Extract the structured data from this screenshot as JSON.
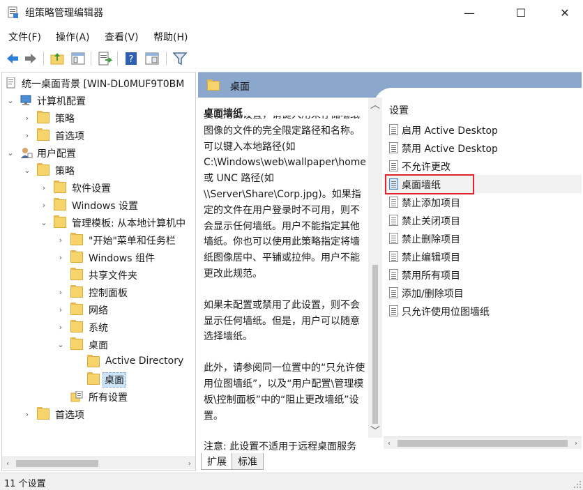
{
  "window": {
    "title": "组策略管理编辑器",
    "controls": {
      "minimize": "—",
      "maximize": "☐",
      "close": "✕"
    }
  },
  "menu": [
    "文件(F)",
    "操作(A)",
    "查看(V)",
    "帮助(H)"
  ],
  "toolbar": [
    "back-icon",
    "forward-icon",
    "up-folder-icon",
    "show-hide-tree-icon",
    "export-list-icon",
    "help-icon",
    "properties-icon",
    "filter-icon"
  ],
  "tree": {
    "items": [
      {
        "label": "统一桌面背景 [WIN-DL0MUF9T0BM",
        "icon": "policy-doc-icon",
        "arrow": ""
      },
      {
        "label": "计算机配置",
        "icon": "computer-icon",
        "arrow": "expanded"
      },
      {
        "label": "策略",
        "icon": "folder-icon",
        "arrow": "collapsed"
      },
      {
        "label": "首选项",
        "icon": "folder-icon",
        "arrow": "collapsed"
      },
      {
        "label": "用户配置",
        "icon": "user-icon",
        "arrow": "expanded"
      },
      {
        "label": "策略",
        "icon": "folder-icon",
        "arrow": "expanded"
      },
      {
        "label": "软件设置",
        "icon": "folder-icon",
        "arrow": "collapsed"
      },
      {
        "label": "Windows 设置",
        "icon": "folder-icon",
        "arrow": "collapsed"
      },
      {
        "label": "管理模板: 从本地计算机中",
        "icon": "folder-icon",
        "arrow": "expanded"
      },
      {
        "label": "\"开始\"菜单和任务栏",
        "icon": "folder-icon",
        "arrow": "collapsed"
      },
      {
        "label": "Windows 组件",
        "icon": "folder-icon",
        "arrow": "collapsed"
      },
      {
        "label": "共享文件夹",
        "icon": "folder-icon",
        "arrow": ""
      },
      {
        "label": "控制面板",
        "icon": "folder-icon",
        "arrow": "collapsed"
      },
      {
        "label": "网络",
        "icon": "folder-icon",
        "arrow": "collapsed"
      },
      {
        "label": "系统",
        "icon": "folder-icon",
        "arrow": "collapsed"
      },
      {
        "label": "桌面",
        "icon": "folder-icon",
        "arrow": "expanded"
      },
      {
        "label": "Active Directory",
        "icon": "folder-icon",
        "arrow": ""
      },
      {
        "label": "桌面",
        "icon": "folder-open-icon",
        "arrow": "",
        "selected": true
      },
      {
        "label": "所有设置",
        "icon": "all-settings-icon",
        "arrow": ""
      },
      {
        "label": "首选项",
        "icon": "folder-icon",
        "arrow": "collapsed"
      }
    ]
  },
  "right": {
    "header": "桌面",
    "description": {
      "title": "桌面墙纸",
      "paragraphs": [
        "要使用此设置，请键入用来存储墙纸图像的文件的完全限定路径和名称。可以键入本地路径(如 C:\\Windows\\web\\wallpaper\\home.jpg)或 UNC 路径(如 \\\\Server\\Share\\Corp.jpg)。如果指定的文件在用户登录时不可用，则不会显示任何墙纸。用户不能指定其他墙纸。你也可以使用此策略指定将墙纸图像居中、平铺或拉伸。用户不能更改此规范。",
        "如果未配置或禁用了此设置，则不会显示任何墙纸。但是，用户可以随意选择墙纸。",
        "此外，请参阅同一位置中的“只允许使用位图墙纸”，以及“用户配置\\管理模板\\控制面板”中的“阻止更改墙纸”设置。",
        "注意: 此设置不适用于远程桌面服务器会话。"
      ]
    },
    "settings_header": "设置",
    "settings": [
      "启用 Active Desktop",
      "禁用 Active Desktop",
      "不允许更改",
      "桌面墙纸",
      "禁止添加项目",
      "禁止关闭项目",
      "禁止删除项目",
      "禁止编辑项目",
      "禁用所有项目",
      "添加/删除项目",
      "只允许使用位图墙纸"
    ],
    "highlighted_setting": "桌面墙纸"
  },
  "tabs": [
    "扩展",
    "标准"
  ],
  "status": "11 个设置",
  "colors": {
    "header_blue": "#8ba8cc",
    "highlight_red": "#e0242b",
    "selection": "#cce4f7"
  }
}
